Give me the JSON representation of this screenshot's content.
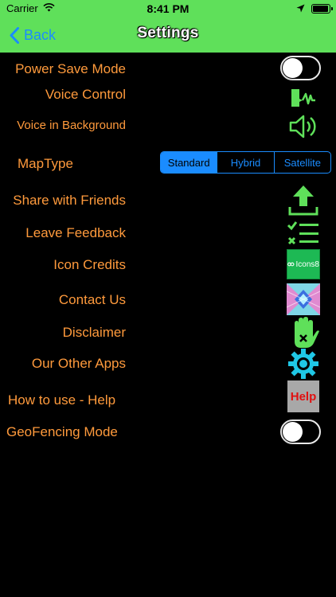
{
  "status": {
    "carrier": "Carrier",
    "time": "8:41 PM"
  },
  "nav": {
    "back_label": "Back",
    "title": "Settings"
  },
  "settings": {
    "power_save": {
      "label": "Power Save Mode",
      "on": false
    },
    "voice_control": {
      "label": "Voice Control"
    },
    "voice_background": {
      "label": "Voice in Background"
    },
    "map_type": {
      "label": "MapType",
      "options": [
        "Standard",
        "Hybrid",
        "Satellite"
      ],
      "selected": "Standard"
    },
    "share": {
      "label": "Share with Friends"
    },
    "feedback": {
      "label": "Leave Feedback"
    },
    "icon_credits": {
      "label": "Icon Credits",
      "icon_text": "Icons8"
    },
    "contact": {
      "label": "Contact Us"
    },
    "disclaimer": {
      "label": "Disclaimer"
    },
    "other_apps": {
      "label": "Our Other Apps"
    },
    "help": {
      "label": "How to use - Help",
      "icon_text": "Help"
    },
    "geofencing": {
      "label": "GeoFencing Mode",
      "on": false
    }
  },
  "colors": {
    "accent": "#5fe05a",
    "label": "#ff9a3c",
    "link": "#1a8cff"
  },
  "icons": [
    "wifi-icon",
    "location-arrow-icon",
    "battery-icon",
    "chevron-left-icon",
    "voice-wave-icon",
    "speaker-icon",
    "upload-icon",
    "checklist-icon",
    "icons8-logo-icon",
    "abstract-pattern-icon",
    "hand-stop-icon",
    "gear-icon",
    "help-icon"
  ]
}
